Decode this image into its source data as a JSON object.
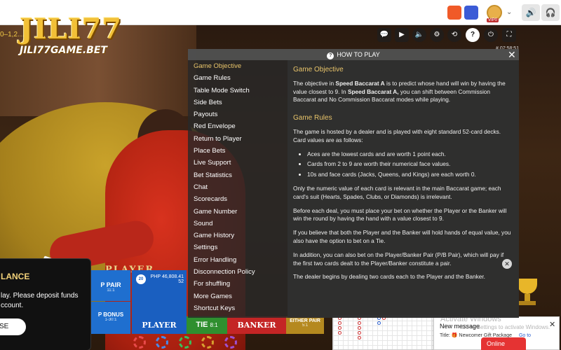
{
  "brand": {
    "logo_main": "JILI77",
    "logo_sub": "JILI77GAME.BET"
  },
  "top_bar": {
    "vip_label": "VIP0",
    "chevron": "⌄",
    "speaker_icon": "🔊",
    "headset_icon": "🎧"
  },
  "video": {
    "timer_text": "0–1,2…",
    "time_text": "# 07:58:51",
    "table_label": "PLAYER"
  },
  "controls": [
    {
      "name": "chat-icon",
      "glyph": "💬"
    },
    {
      "name": "camera-icon",
      "glyph": "▶"
    },
    {
      "name": "volume-icon",
      "glyph": "🔈"
    },
    {
      "name": "settings-icon",
      "glyph": "⚙"
    },
    {
      "name": "history-icon",
      "glyph": "⟲"
    },
    {
      "name": "help-icon",
      "glyph": "?"
    },
    {
      "name": "exit-icon",
      "glyph": "⏻"
    },
    {
      "name": "fullscreen-icon",
      "glyph": "⛶"
    }
  ],
  "bet_board": {
    "ppair_label": "P PAIR",
    "ppair_odds": "11:1",
    "pbonus_label": "P BONUS",
    "pbonus_odds": "1-30:1",
    "player_label": "PLAYER",
    "player_amount": "PHP 46,808.41",
    "player_count": "52",
    "player_badge": "20",
    "tie_label": "TIE",
    "tie_odds": "8:1",
    "banker_label": "BANKER",
    "either_label": "EITHER PAIR",
    "either_odds": "5:1"
  },
  "balance_popup": {
    "title": "LANCE",
    "message": "lay. Please deposit funds ccount.",
    "button": "SE"
  },
  "notification": {
    "title": "New message",
    "line": "Title: 🎁 Newcomer Gift Package",
    "goto": "Go to",
    "close": "✕",
    "watermark_1": "Activate Windows",
    "watermark_2": "Go to Settings to activate Windows."
  },
  "online_label": "Online",
  "how_to_play": {
    "header": "HOW TO PLAY",
    "close": "✕",
    "nav": [
      "Game Objective",
      "Game Rules",
      "Table Mode Switch",
      "Side Bets",
      "Payouts",
      "Red Envelope",
      "Return to Player",
      "Place Bets",
      "Live Support",
      "Bet Statistics",
      "Chat",
      "Scorecards",
      "Game Number",
      "Sound",
      "Game History",
      "Settings",
      "Error Handling",
      "Disconnection Policy",
      "For shuffling",
      "More Games",
      "Shortcut Keys"
    ],
    "active_index": 0,
    "objective_heading": "Game Objective",
    "objective_part1": "The objective in ",
    "objective_bold1": "Speed Baccarat A",
    "objective_part2": " is to predict whose hand will win by having the value closest to 9. In ",
    "objective_bold2": "Speed Baccarat A,",
    "objective_part3": " you can shift between Commission Baccarat and No Commission Baccarat modes while playing.",
    "rules_heading": "Game Rules",
    "rules_intro": "The game is hosted by a dealer and is played with eight standard 52-card decks. Card values are as follows:",
    "rules_list": [
      "Aces are the lowest cards and are worth 1 point each.",
      "Cards from 2 to 9 are worth their numerical face values.",
      "10s and face cards (Jacks, Queens, and Kings) are each worth 0."
    ],
    "rules_p2": "Only the numeric value of each card is relevant in the main Baccarat game; each card's suit (Hearts, Spades, Clubs, or Diamonds) is irrelevant.",
    "rules_p3": "Before each deal, you must place your bet on whether the Player or the Banker will win the round by having the hand with a value closest to 9.",
    "rules_p4": "If you believe that both the Player and the Banker will hold hands of equal value, you also have the option to bet on a Tie.",
    "rules_p5": "In addition, you can also bet on the Player/Banker Pair (P/B Pair), which will pay if the first two cards dealt to the Player/Banker constitute a pair.",
    "rules_p6": "The dealer begins by dealing two cards each to the Player and the Banker.",
    "content_close": "✕"
  },
  "colors": {
    "accent_gold": "#e8c46a",
    "player_blue": "#1a5fc0",
    "banker_red": "#c42525",
    "tie_green": "#2f8f2f"
  }
}
